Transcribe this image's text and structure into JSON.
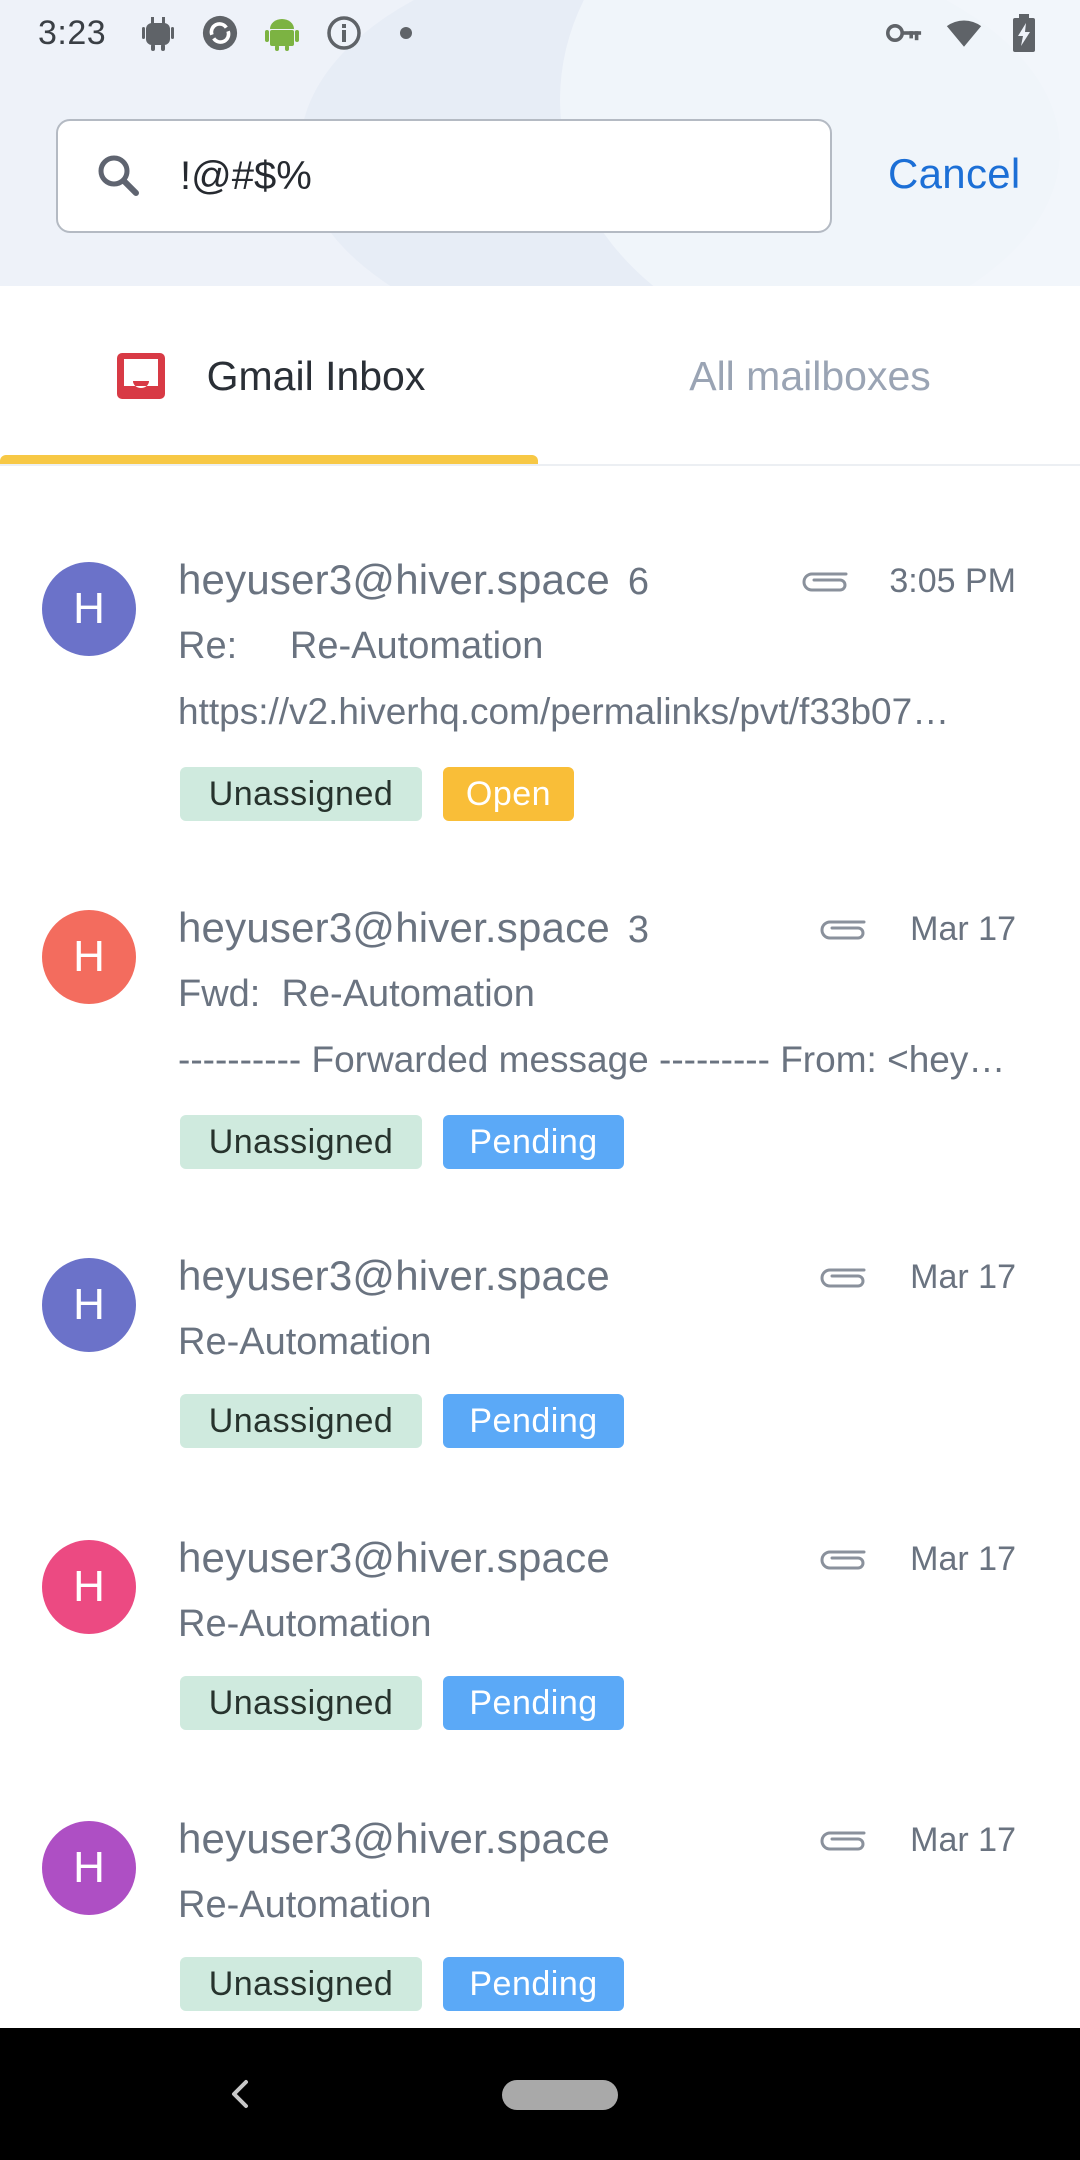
{
  "status_bar": {
    "time": "3:23",
    "left_icons": [
      "android-debug-icon",
      "sync-icon",
      "android-icon",
      "info-icon",
      "dot-icon"
    ],
    "right_icons": [
      "vpn-key-icon",
      "wifi-icon",
      "battery-charging-icon"
    ]
  },
  "search": {
    "value": "!@#$%",
    "placeholder": "",
    "cancel_label": "Cancel"
  },
  "tabs": {
    "gmail_label": "Gmail Inbox",
    "all_label": "All mailboxes",
    "active": "Gmail Inbox"
  },
  "emails": [
    {
      "avatar_letter": "H",
      "avatar_color": "#6b72c9",
      "sender": "heyuser3@hiver.space",
      "count": "6",
      "date": "3:05 PM",
      "subject": "Re:     Re-Automation",
      "preview": "https://v2.hiverhq.com/permalinks/pvt/f33b07…",
      "assignee": "Unassigned",
      "status": "Open",
      "status_color": "#f9be38"
    },
    {
      "avatar_letter": "H",
      "avatar_color": "#f36c5e",
      "sender": "heyuser3@hiver.space",
      "count": "3",
      "date": "Mar 17",
      "subject": "Fwd:  Re-Automation",
      "preview": "---------- Forwarded message --------- From: <heyu…",
      "assignee": "Unassigned",
      "status": "Pending",
      "status_color": "#5ba9f7"
    },
    {
      "avatar_letter": "H",
      "avatar_color": "#6b72c9",
      "sender": "heyuser3@hiver.space",
      "count": "",
      "date": "Mar 17",
      "subject": "Re-Automation",
      "preview": "",
      "assignee": "Unassigned",
      "status": "Pending",
      "status_color": "#5ba9f7"
    },
    {
      "avatar_letter": "H",
      "avatar_color": "#ec4a82",
      "sender": "heyuser3@hiver.space",
      "count": "",
      "date": "Mar 17",
      "subject": "Re-Automation",
      "preview": "",
      "assignee": "Unassigned",
      "status": "Pending",
      "status_color": "#5ba9f7"
    },
    {
      "avatar_letter": "H",
      "avatar_color": "#ae4fc4",
      "sender": "heyuser3@hiver.space",
      "count": "",
      "date": "Mar 17",
      "subject": "Re-Automation",
      "preview": "",
      "assignee": "Unassigned",
      "status": "Pending",
      "status_color": "#5ba9f7"
    }
  ],
  "colors": {
    "accent": "#1c6fd6",
    "tab_indicator": "#f7c845",
    "unassigned_tag": "#cfeade",
    "inbox_icon": "#d83a45"
  }
}
